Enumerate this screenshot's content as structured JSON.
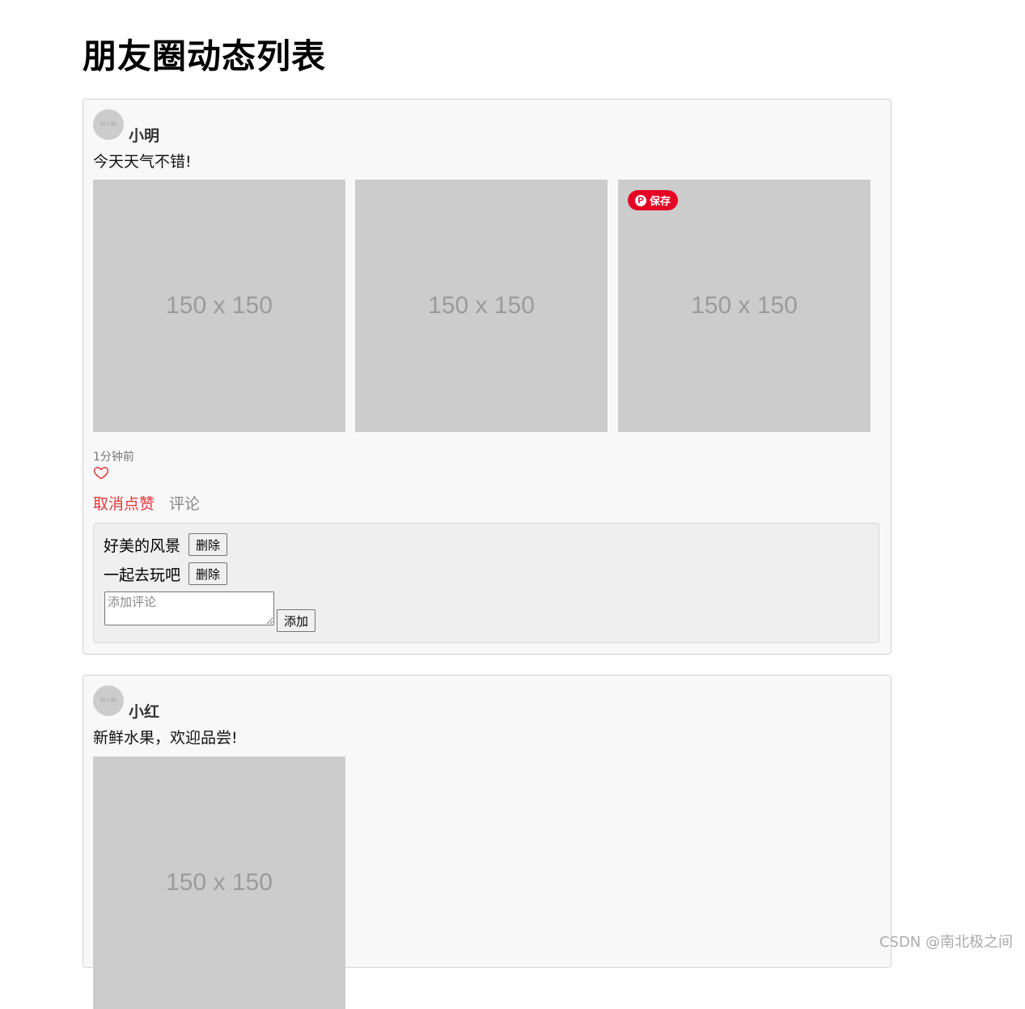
{
  "page": {
    "title": "朋友圈动态列表"
  },
  "posts": [
    {
      "avatar_text": "50 x 50",
      "username": "小明",
      "content": "今天天气不错!",
      "images": [
        "150 x 150",
        "150 x 150",
        "150 x 150"
      ],
      "save_badge": "保存",
      "time": "1分钟前",
      "actions": {
        "unlike": "取消点赞",
        "comment": "评论"
      },
      "comments": [
        {
          "text": "好美的风景",
          "delete_label": "删除"
        },
        {
          "text": "一起去玩吧",
          "delete_label": "删除"
        }
      ],
      "comment_input": {
        "placeholder": "添加评论",
        "value": ""
      },
      "add_label": "添加"
    },
    {
      "avatar_text": "50 x 50",
      "username": "小红",
      "content": "新鲜水果，欢迎品尝!",
      "images": [
        "150 x 150"
      ]
    }
  ],
  "watermark": "CSDN @南北极之间",
  "colors": {
    "accent_red": "#e4393c",
    "pinterest_red": "#e60023",
    "placeholder_gray": "#cccccc"
  },
  "icons": {
    "like": "heart-outline-icon",
    "pin": "pinterest-icon"
  }
}
